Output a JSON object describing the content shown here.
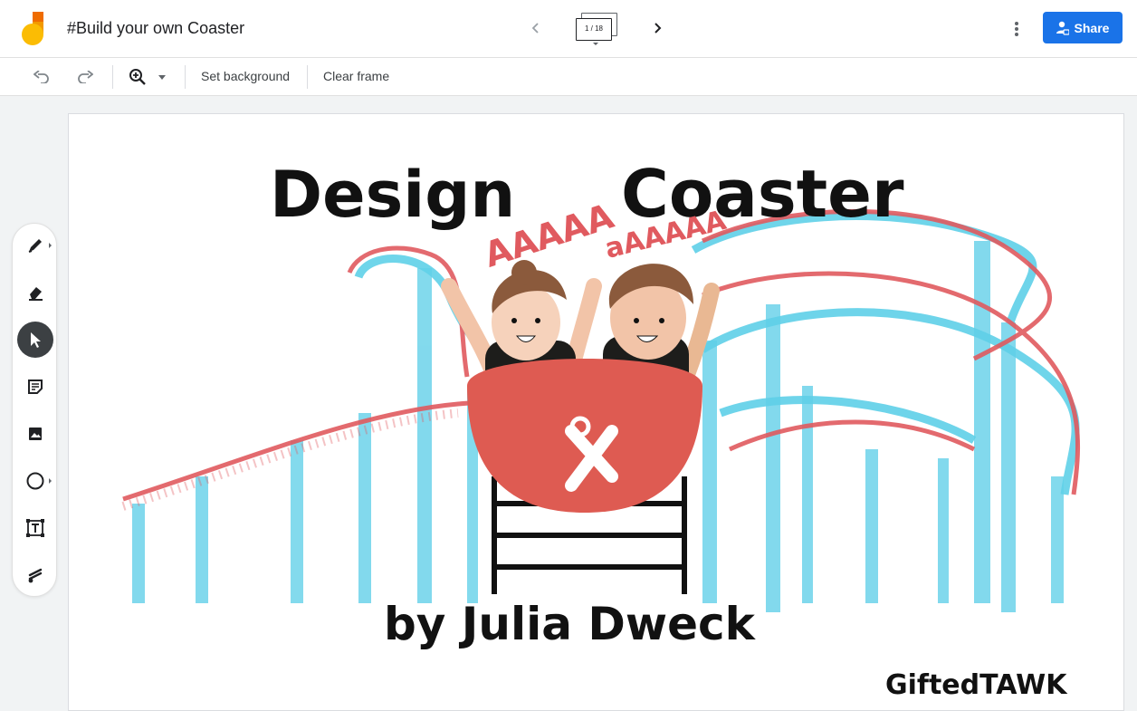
{
  "header": {
    "title": "#Build your own Coaster",
    "frame_counter": "1 / 18",
    "share_label": "Share"
  },
  "toolbar": {
    "set_background": "Set background",
    "clear_frame": "Clear frame"
  },
  "canvas": {
    "title_left": "Design",
    "title_right": "Coaster",
    "scream_1": "AAAAA",
    "scream_2": "aAAAAA",
    "byline": "by Julia Dweck",
    "credit": "GiftedTAWK"
  },
  "colors": {
    "accent_blue": "#1a73e8",
    "track_red": "#e05a5f",
    "track_blue": "#5fd0e8",
    "car_red": "#de5b52",
    "tool_active": "#3c4043"
  },
  "side_tools": [
    {
      "name": "pen-tool",
      "icon": "pen-icon"
    },
    {
      "name": "eraser-tool",
      "icon": "eraser-icon"
    },
    {
      "name": "select-tool",
      "icon": "pointer-icon",
      "active": true
    },
    {
      "name": "sticky-note-tool",
      "icon": "sticky-note-icon"
    },
    {
      "name": "add-image-tool",
      "icon": "image-icon"
    },
    {
      "name": "circle-tool",
      "icon": "circle-icon"
    },
    {
      "name": "text-box-tool",
      "icon": "text-box-icon"
    },
    {
      "name": "laser-tool",
      "icon": "laser-icon"
    }
  ]
}
